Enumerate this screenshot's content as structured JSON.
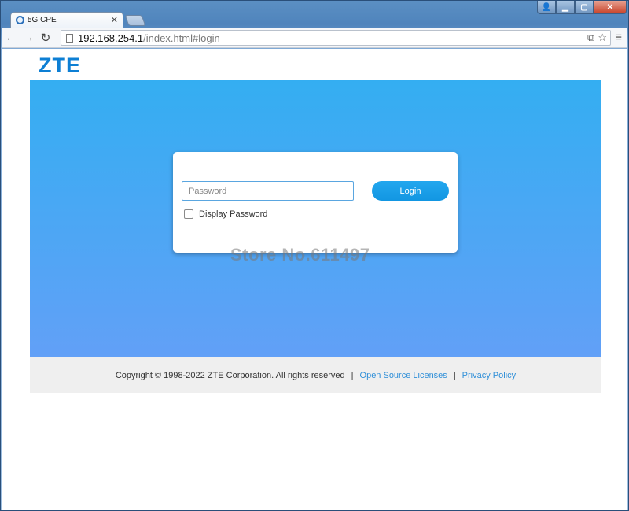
{
  "browser": {
    "tab_title": "5G CPE",
    "tab_close": "✕",
    "url_host": "192.168.254.1",
    "url_path": "/index.html#login",
    "nav_back": "←",
    "nav_forward": "→",
    "nav_reload": "↻",
    "menu": "≡",
    "translate": "⧉",
    "bookmark": "☆",
    "win_user": "👤",
    "win_min": "▁",
    "win_max": "▢",
    "win_close": "✕"
  },
  "page": {
    "logo": "ZTE",
    "login": {
      "password_placeholder": "Password",
      "login_button": "Login",
      "show_password_label": "Display Password"
    },
    "watermark": "Store No.611497",
    "footer": {
      "copyright": "Copyright © 1998-2022 ZTE Corporation. All rights reserved",
      "separator": "|",
      "oss_link": "Open Source Licenses",
      "privacy_link": "Privacy Policy"
    }
  },
  "colors": {
    "brand": "#0d7fd4",
    "hero_top": "#34aef2",
    "hero_bottom": "#62a0f7",
    "link": "#2f8fd8"
  }
}
